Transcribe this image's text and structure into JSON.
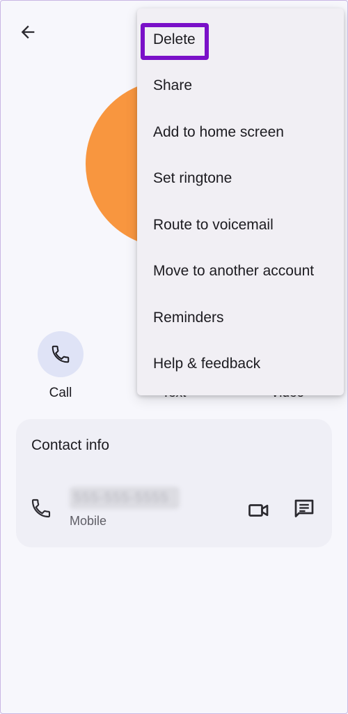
{
  "header": {
    "back_icon": "arrow-back-icon"
  },
  "avatar": {
    "color": "#f8963f"
  },
  "actions": [
    {
      "label": "Call",
      "icon": "phone-icon"
    },
    {
      "label": "Text",
      "icon": "message-icon"
    },
    {
      "label": "Video",
      "icon": "video-icon"
    }
  ],
  "contact_info": {
    "title": "Contact info",
    "phone": {
      "number": "555-555-5555",
      "type": "Mobile"
    }
  },
  "overflow_menu": {
    "items": [
      "Delete",
      "Share",
      "Add to home screen",
      "Set ringtone",
      "Route to voicemail",
      "Move to another account",
      "Reminders",
      "Help & feedback"
    ],
    "highlight_color": "#7a10c8"
  }
}
